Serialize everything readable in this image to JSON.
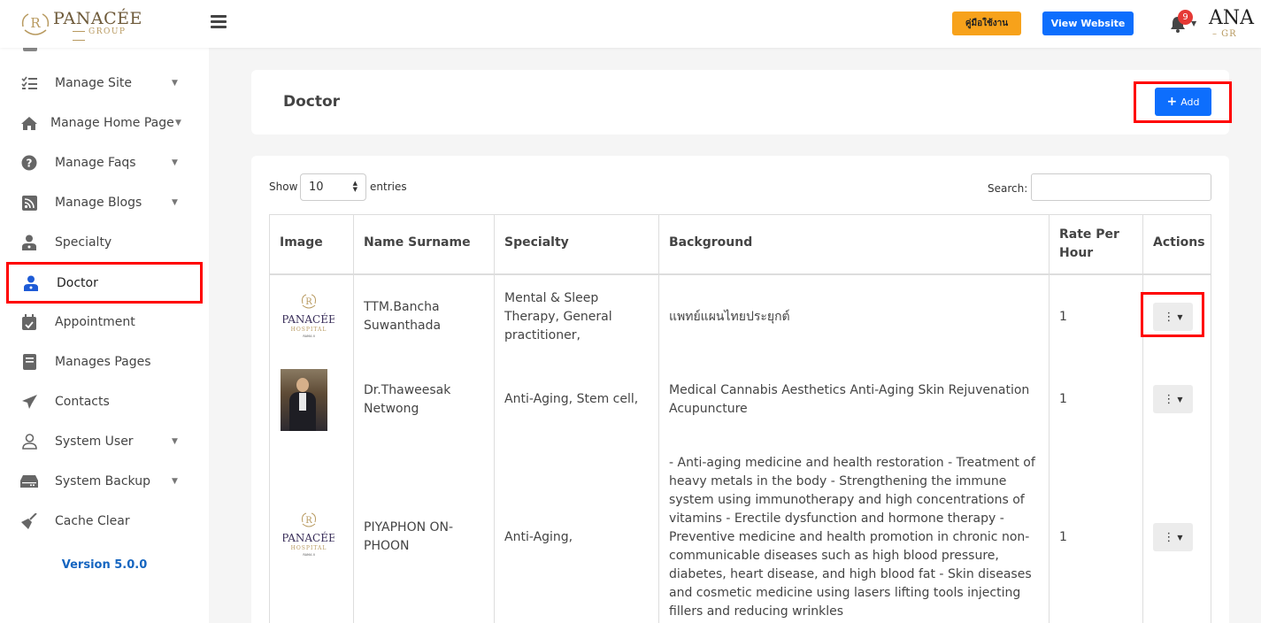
{
  "brand": {
    "name": "PANACÉE",
    "sub": "GROUP",
    "right_name": "ANA",
    "right_sub": "– GR"
  },
  "topbar": {
    "manual_label": "คู่มือใช้งาน",
    "website_label": "View Website",
    "notifications": "9"
  },
  "sidebar": {
    "items": [
      {
        "label": "Manage Site",
        "icon": "list-check-icon",
        "caret": true
      },
      {
        "label": "Manage Home Page",
        "icon": "home-icon",
        "caret": true
      },
      {
        "label": "Manage Faqs",
        "icon": "question-circle-icon",
        "caret": true
      },
      {
        "label": "Manage Blogs",
        "icon": "rss-icon",
        "caret": true
      },
      {
        "label": "Specialty",
        "icon": "user-doctor-icon",
        "caret": false
      },
      {
        "label": "Doctor",
        "icon": "user-doctor-icon",
        "caret": false,
        "active": true
      },
      {
        "label": "Appointment",
        "icon": "calendar-check-icon",
        "caret": false
      },
      {
        "label": "Manages Pages",
        "icon": "book-icon",
        "caret": false
      },
      {
        "label": "Contacts",
        "icon": "paper-plane-icon",
        "caret": false
      },
      {
        "label": "System User",
        "icon": "user-icon",
        "caret": true
      },
      {
        "label": "System Backup",
        "icon": "hdd-icon",
        "caret": true
      },
      {
        "label": "Cache Clear",
        "icon": "broom-icon",
        "caret": false
      }
    ],
    "version": "Version 5.0.0"
  },
  "page": {
    "title": "Doctor",
    "add_label": "Add"
  },
  "table_controls": {
    "show_label": "Show",
    "entries_value": "10",
    "entries_label": "entries",
    "search_label": "Search:"
  },
  "table": {
    "headers": [
      "Image",
      "Name Surname",
      "Specialty",
      "Background",
      "Rate Per Hour",
      "Actions"
    ],
    "rows": [
      {
        "image": "logo",
        "name": "TTM.Bancha Suwanthada",
        "specialty": "Mental & Sleep Therapy, General practitioner,",
        "background": "แพทย์แผนไทยประยุกต์",
        "rate": "1"
      },
      {
        "image": "photo",
        "name": "Dr.Thaweesak Netwong",
        "specialty": "Anti-Aging, Stem cell,",
        "background": "Medical Cannabis Aesthetics Anti-Aging Skin Rejuvenation Acupuncture",
        "rate": "1"
      },
      {
        "image": "logo",
        "name": "PIYAPHON ON-PHOON",
        "specialty": "Anti-Aging,",
        "background": "- Anti-aging medicine and health restoration - Treatment of heavy metals in the body - Strengthening the immune system using immunotherapy and high concentrations of vitamins - Erectile dysfunction and hormone therapy - Preventive medicine and health promotion in chronic non-communicable diseases such as high blood pressure, diabetes, heart disease, and high blood fat - Skin diseases and cosmetic medicine using lasers lifting tools injecting fillers and reducing wrinkles",
        "rate": "1"
      }
    ]
  },
  "thumb_logo": {
    "name": "PANACÉE",
    "sub": "HOSPITAL",
    "tiny": "RAMA II"
  },
  "colors": {
    "primary": "#0d6efd",
    "warning": "#f7a21b",
    "highlight": "#ff0000",
    "gold": "#b89a60"
  }
}
